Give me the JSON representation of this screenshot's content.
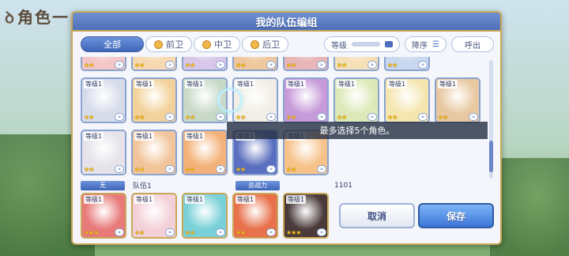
{
  "background": {
    "title": "角色一"
  },
  "dialog": {
    "title": "我的队伍编组"
  },
  "filters": [
    {
      "label": "全部",
      "active": true
    },
    {
      "label": "前卫",
      "active": false
    },
    {
      "label": "中卫",
      "active": false
    },
    {
      "label": "后卫",
      "active": false
    }
  ],
  "sort": {
    "level_label": "等级",
    "order_label": "降序",
    "call_label": "呼出"
  },
  "roster": {
    "toast": "最多选择5个角色。",
    "cards": [
      {
        "level": "",
        "stars": "★★",
        "color": "#f3c7c7"
      },
      {
        "level": "",
        "stars": "★★",
        "color": "#f6d9b0"
      },
      {
        "level": "",
        "stars": "★★",
        "color": "#d8c7e8"
      },
      {
        "level": "",
        "stars": "★★",
        "color": "#f0c8a0"
      },
      {
        "level": "",
        "stars": "★★",
        "color": "#e8b6b6"
      },
      {
        "level": "",
        "stars": "★★",
        "color": "#f6e0b8"
      },
      {
        "level": "",
        "stars": "★★",
        "color": "#c9d8ee"
      },
      {
        "level": "等级1",
        "stars": "★★",
        "color": "#d7dcea"
      },
      {
        "level": "等级1",
        "stars": "★★",
        "color": "#f2d29a"
      },
      {
        "level": "等级1",
        "stars": "★★",
        "color": "#c8d9c8"
      },
      {
        "level": "等级1",
        "stars": "★★",
        "color": "#f2eee6"
      },
      {
        "level": "等级1",
        "stars": "★★",
        "color": "#c79ad9"
      },
      {
        "level": "等级1",
        "stars": "★★",
        "color": "#dde9b8"
      },
      {
        "level": "等级1",
        "stars": "★★",
        "color": "#f5e6b0"
      },
      {
        "level": "等级1",
        "stars": "★★",
        "color": "#e8c8a0"
      },
      {
        "level": "等级1",
        "stars": "★★",
        "color": "#e5e2ea"
      },
      {
        "level": "等级1",
        "stars": "★★",
        "color": "#f2c49a"
      },
      {
        "level": "等级1",
        "stars": "★★",
        "color": "#f4b27a"
      },
      {
        "level": "等级1",
        "stars": "★★",
        "color": "#5a6fbf"
      },
      {
        "level": "等级1",
        "stars": "★★",
        "color": "#f6c28a"
      }
    ]
  },
  "team": {
    "badge": "无",
    "name": "队伍1",
    "power_label": "总战力",
    "power_value": "1101",
    "members": [
      {
        "level": "等级1",
        "stars": "★★★",
        "color": "#e87a7a"
      },
      {
        "level": "等级1",
        "stars": "★★",
        "color": "#f3d0d8"
      },
      {
        "level": "等级1",
        "stars": "★★",
        "color": "#7ad0d8"
      },
      {
        "level": "等级1",
        "stars": "★★",
        "color": "#e8704a"
      },
      {
        "level": "等级1",
        "stars": "★★★",
        "color": "#4a3a3a"
      }
    ]
  },
  "buttons": {
    "cancel": "取消",
    "save": "保存"
  },
  "colors": {
    "accent": "#4f70b8",
    "gold": "#c9a75a",
    "star": "#f2b91d"
  }
}
